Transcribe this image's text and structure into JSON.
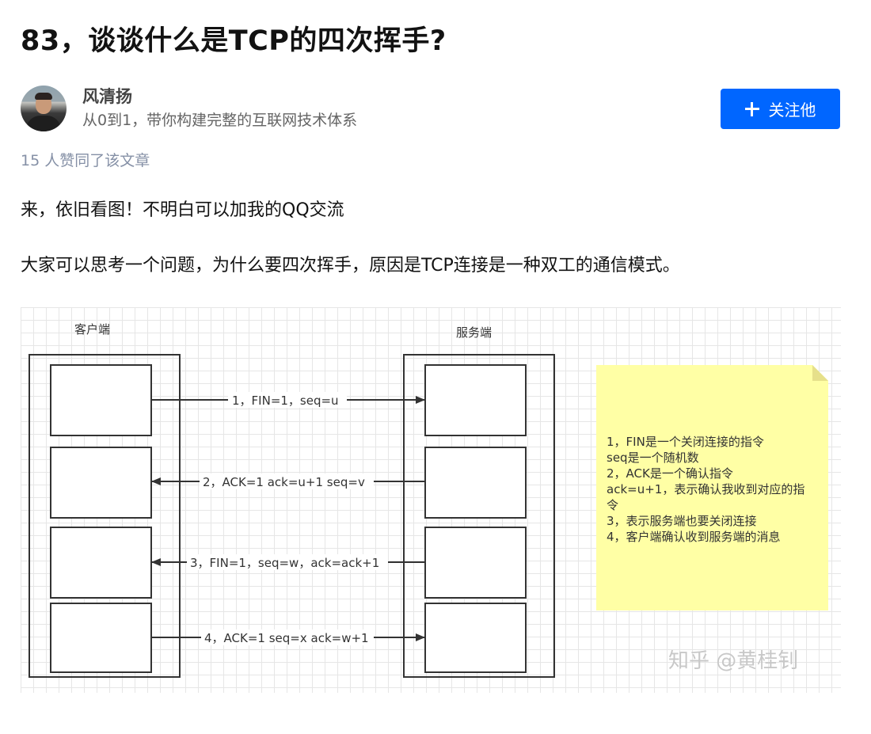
{
  "article": {
    "title": "83，谈谈什么是TCP的四次挥手?",
    "likes": "15 人赞同了该文章",
    "paragraphs": [
      "来，依旧看图！不明白可以加我的QQ交流",
      "大家可以思考一个问题，为什么要四次挥手，原因是TCP连接是一种双工的通信模式。"
    ]
  },
  "author": {
    "name": "风清扬",
    "bio": "从0到1，带你构建完整的互联网技术体系",
    "follow_label": "关注他",
    "follow_color": "#0066ff"
  },
  "figure": {
    "client_label": "客户端",
    "server_label": "服务端",
    "arrows": [
      {
        "label": "1，FIN=1，seq=u",
        "direction": "to-server"
      },
      {
        "label": "2，ACK=1 ack=u+1 seq=v",
        "direction": "to-client"
      },
      {
        "label": "3，FIN=1，seq=w，ack=ack+1",
        "direction": "to-client"
      },
      {
        "label": "4，ACK=1 seq=x ack=w+1",
        "direction": "to-server"
      }
    ],
    "note_lines": [
      "1，FIN是一个关闭连接的指令",
      "seq是一个随机数",
      "2，ACK是一个确认指令",
      "ack=u+1，表示确认我收到对应的指",
      "令",
      "3，表示服务端也要关闭连接",
      "4，客户端确认收到服务端的消息"
    ],
    "note_color": "#ffffa5",
    "watermark": "知乎 @黄桂钊"
  }
}
